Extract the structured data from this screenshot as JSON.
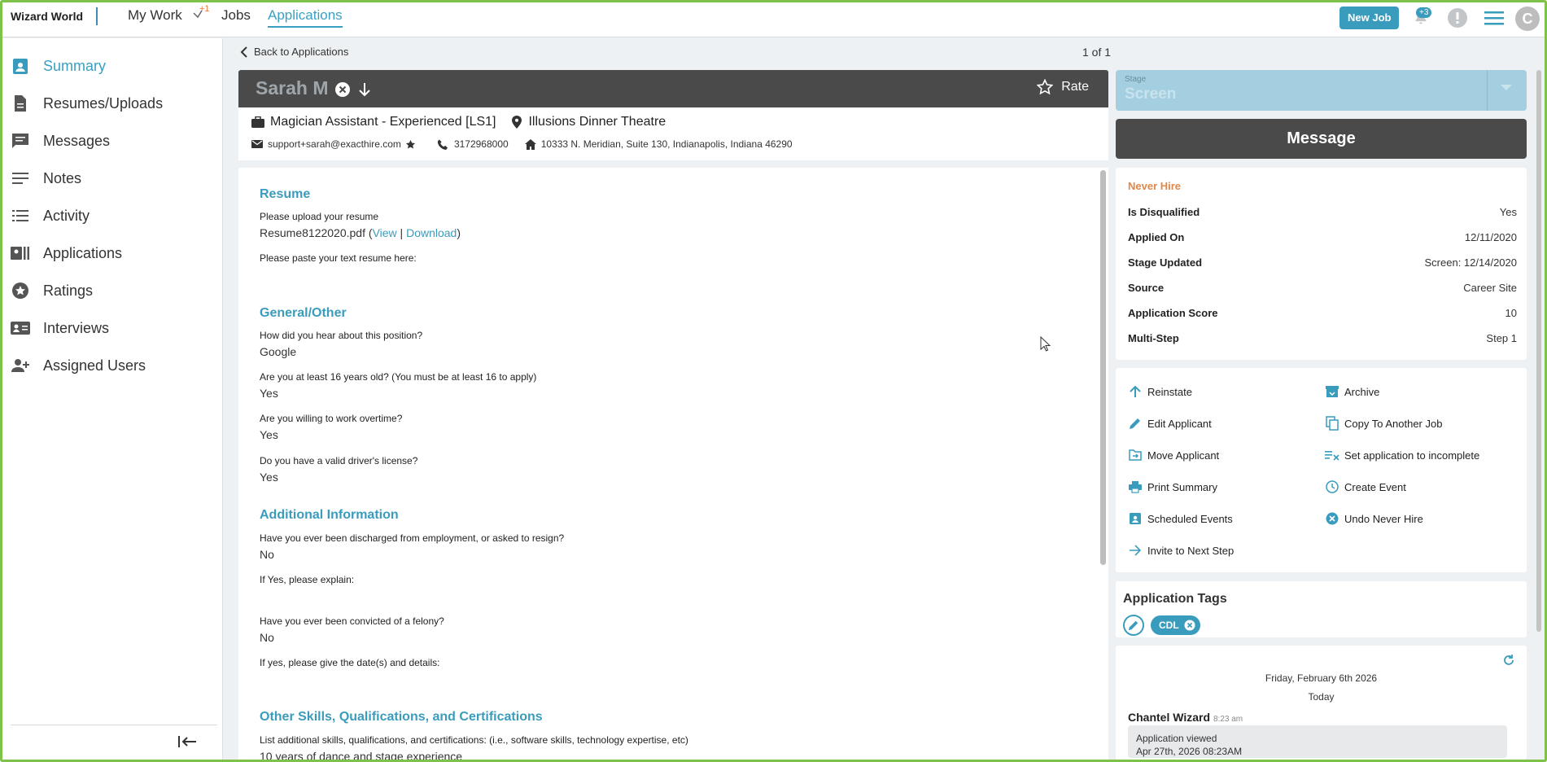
{
  "app": {
    "brand": "Wizard World"
  },
  "nav": {
    "my_work": "My Work",
    "my_work_badge": "+1",
    "jobs": "Jobs",
    "applications": "Applications"
  },
  "topbar": {
    "new_job": "New Job",
    "notif_count": "+3",
    "avatar_initial": "C"
  },
  "sidebar": {
    "items": [
      {
        "label": "Summary",
        "icon": "clipboard-user-icon"
      },
      {
        "label": "Resumes/Uploads",
        "icon": "document-icon"
      },
      {
        "label": "Messages",
        "icon": "chat-icon"
      },
      {
        "label": "Notes",
        "icon": "notes-icon"
      },
      {
        "label": "Activity",
        "icon": "list-icon"
      },
      {
        "label": "Applications",
        "icon": "applications-icon"
      },
      {
        "label": "Ratings",
        "icon": "star-circle-icon"
      },
      {
        "label": "Interviews",
        "icon": "contact-card-icon"
      },
      {
        "label": "Assigned Users",
        "icon": "user-add-icon"
      }
    ]
  },
  "header": {
    "back": "Back to Applications",
    "pager": "1 of 1",
    "name": "Sarah M",
    "rate": "Rate",
    "job_title": "Magician Assistant - Experienced [LS1]",
    "location": "Illusions Dinner Theatre",
    "email": "support+sarah@exacthire.com",
    "phone": "3172968000",
    "address": "10333 N. Meridian, Suite 130, Indianapolis, Indiana 46290"
  },
  "resume": {
    "sec_resume": "Resume",
    "q_upload": "Please upload your resume",
    "file": "Resume8122020.pdf",
    "view": "View",
    "download": "Download",
    "q_paste": "Please paste your text resume here:",
    "sec_general": "General/Other",
    "q1": "How did you hear about this position?",
    "a1": "Google",
    "q2": "Are you at least 16 years old? (You must be at least 16 to apply)",
    "a2": "Yes",
    "q3": "Are you willing to work overtime?",
    "a3": "Yes",
    "q4": "Do you have a valid driver's license?",
    "a4": "Yes",
    "sec_additional": "Additional Information",
    "q5": "Have you ever been discharged from employment, or asked to resign?",
    "a5": "No",
    "q6": "If Yes, please explain:",
    "q7": "Have you ever been convicted of a felony?",
    "a7": "No",
    "q8": "If yes, please give the date(s) and details:",
    "sec_skills": "Other Skills, Qualifications, and Certifications",
    "q9": "List additional skills, qualifications, and certifications: (i.e., software skills, technology expertise, etc)",
    "a9": "10 years of dance and stage experience"
  },
  "stage": {
    "label": "Stage",
    "value": "Screen"
  },
  "message_btn": "Message",
  "status": {
    "never_hire": "Never Hire",
    "rows": [
      {
        "k": "Is Disqualified",
        "v": "Yes"
      },
      {
        "k": "Applied On",
        "v": "12/11/2020"
      },
      {
        "k": "Stage Updated",
        "v": "Screen: 12/14/2020"
      },
      {
        "k": "Source",
        "v": "Career Site"
      },
      {
        "k": "Application Score",
        "v": "10"
      },
      {
        "k": "Multi-Step",
        "v": "Step 1"
      }
    ]
  },
  "actions": {
    "reinstate": "Reinstate",
    "archive": "Archive",
    "edit_applicant": "Edit Applicant",
    "copy_job": "Copy To Another Job",
    "move_applicant": "Move Applicant",
    "set_incomplete": "Set application to incomplete",
    "print_summary": "Print Summary",
    "create_event": "Create Event",
    "scheduled_events": "Scheduled Events",
    "undo_never_hire": "Undo Never Hire",
    "invite_next": "Invite to Next Step"
  },
  "tags": {
    "title": "Application Tags",
    "items": [
      "CDL"
    ]
  },
  "activity": {
    "date": "Friday, February 6th 2026",
    "today": "Today",
    "who": "Chantel Wizard",
    "time": "8:23 am",
    "event": "Application viewed",
    "event_time": "Apr 27th, 2026 08:23AM"
  },
  "colors": {
    "accent": "#3a9cbd",
    "warning": "#e0874a",
    "frame": "#7dc34a",
    "header_bg": "#4a4a4a"
  }
}
